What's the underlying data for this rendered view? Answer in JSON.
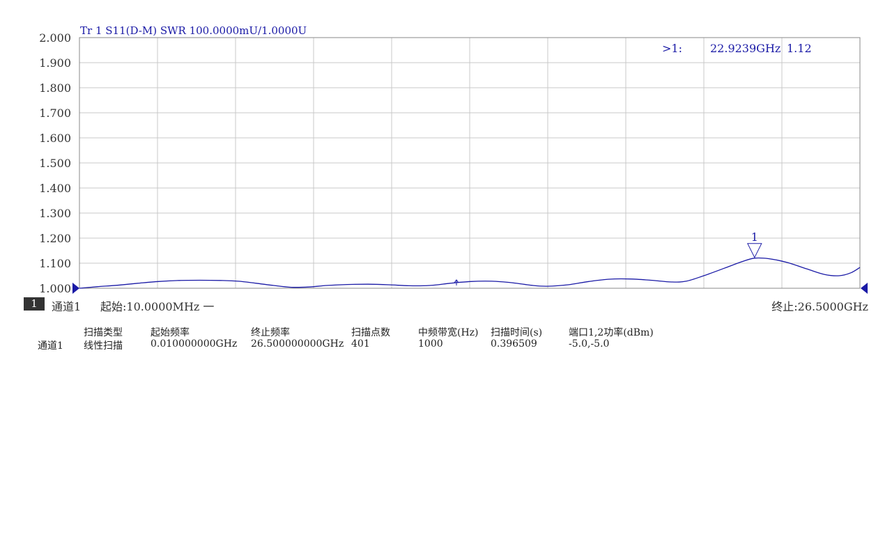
{
  "trace": {
    "label": "Tr 1  S11(D-M) SWR 100.0000mU/1.0000U"
  },
  "marker": {
    "readout_prefix": ">1:",
    "freq": "22.9239GHz",
    "value": "1.12",
    "label": "1"
  },
  "channel": {
    "number": "1",
    "name": "通道1",
    "start": "起始:10.0000MHz 一",
    "stop": "终止:26.5000GHz"
  },
  "info_table": {
    "headers": [
      "扫描类型",
      "起始频率",
      "终止频率",
      "扫描点数",
      "中频带宽(Hz)",
      "扫描时间(s)",
      "端口1,2功率(dBm)"
    ],
    "row_label": "通道1",
    "values": [
      "线性扫描",
      "0.010000000GHz",
      "26.500000000GHz",
      "401",
      "1000",
      "0.396509",
      "-5.0,-5.0"
    ]
  },
  "colors": {
    "trace": "#1a1aa6",
    "grid": "#c8c8c8",
    "frame": "#888888"
  },
  "chart_data": {
    "type": "line",
    "title": "Tr 1  S11(D-M) SWR 100.0000mU/1.0000U",
    "xlabel": "",
    "ylabel": "",
    "xlim": [
      0.01,
      26.5
    ],
    "ylim": [
      1.0,
      2.0
    ],
    "grid": true,
    "y_ticks": [
      "2.000",
      "1.900",
      "1.800",
      "1.700",
      "1.600",
      "1.500",
      "1.400",
      "1.300",
      "1.200",
      "1.100",
      "1.000"
    ],
    "series": [
      {
        "values": [
          [
            0.01,
            1.0
          ],
          [
            0.6,
            1.006
          ],
          [
            1.3,
            1.012
          ],
          [
            2.0,
            1.02
          ],
          [
            2.7,
            1.027
          ],
          [
            3.4,
            1.031
          ],
          [
            4.1,
            1.032
          ],
          [
            4.8,
            1.031
          ],
          [
            5.4,
            1.028
          ],
          [
            6.0,
            1.02
          ],
          [
            6.6,
            1.011
          ],
          [
            7.2,
            1.004
          ],
          [
            7.8,
            1.005
          ],
          [
            8.4,
            1.011
          ],
          [
            9.1,
            1.015
          ],
          [
            9.8,
            1.016
          ],
          [
            10.5,
            1.014
          ],
          [
            11.2,
            1.01
          ],
          [
            11.9,
            1.011
          ],
          [
            12.6,
            1.02
          ],
          [
            13.3,
            1.027
          ],
          [
            14.0,
            1.028
          ],
          [
            14.7,
            1.022
          ],
          [
            15.4,
            1.011
          ],
          [
            15.9,
            1.008
          ],
          [
            16.6,
            1.014
          ],
          [
            17.3,
            1.027
          ],
          [
            18.0,
            1.036
          ],
          [
            18.7,
            1.037
          ],
          [
            19.4,
            1.032
          ],
          [
            20.1,
            1.025
          ],
          [
            20.6,
            1.028
          ],
          [
            21.2,
            1.05
          ],
          [
            21.9,
            1.08
          ],
          [
            22.5,
            1.106
          ],
          [
            22.92,
            1.12
          ],
          [
            23.4,
            1.118
          ],
          [
            24.0,
            1.104
          ],
          [
            24.7,
            1.077
          ],
          [
            25.3,
            1.055
          ],
          [
            25.8,
            1.05
          ],
          [
            26.2,
            1.062
          ],
          [
            26.5,
            1.083
          ]
        ]
      }
    ],
    "marker": {
      "x": 22.9239,
      "y": 1.12
    }
  }
}
